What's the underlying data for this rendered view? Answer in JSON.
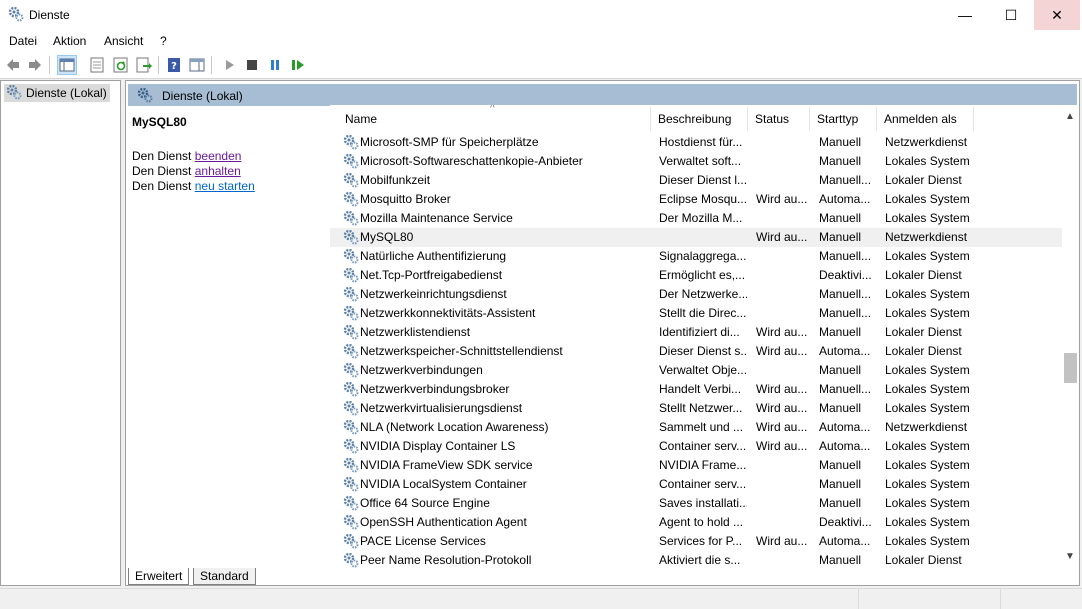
{
  "window": {
    "title": "Dienste",
    "icon": "gears-icon",
    "minimize": "—",
    "maximize": "☐",
    "close": "✕"
  },
  "menu": [
    "Datei",
    "Aktion",
    "Ansicht",
    "?"
  ],
  "tree": {
    "root": "Dienste (Lokal)"
  },
  "content": {
    "header": "Dienste (Lokal)",
    "extended": {
      "selected_service": "MySQL80",
      "line_prefix": "Den Dienst",
      "actions": [
        "beenden",
        "anhalten",
        "neu starten"
      ]
    }
  },
  "columns": [
    "Name",
    "Beschreibung",
    "Status",
    "Starttyp",
    "Anmelden als"
  ],
  "services": [
    {
      "name": "Microsoft-SMP für Speicherplätze",
      "description": "Hostdienst für...",
      "status": "",
      "startup": "Manuell",
      "logon": "Netzwerkdienst"
    },
    {
      "name": "Microsoft-Softwareschattenkopie-Anbieter",
      "description": "Verwaltet soft...",
      "status": "",
      "startup": "Manuell",
      "logon": "Lokales System"
    },
    {
      "name": "Mobilfunkzeit",
      "description": "Dieser Dienst l...",
      "status": "",
      "startup": "Manuell...",
      "logon": "Lokaler Dienst"
    },
    {
      "name": "Mosquitto Broker",
      "description": "Eclipse Mosqu...",
      "status": "Wird au...",
      "startup": "Automa...",
      "logon": "Lokales System"
    },
    {
      "name": "Mozilla Maintenance Service",
      "description": "Der Mozilla M...",
      "status": "",
      "startup": "Manuell",
      "logon": "Lokales System"
    },
    {
      "name": "MySQL80",
      "description": "",
      "status": "Wird au...",
      "startup": "Manuell",
      "logon": "Netzwerkdienst",
      "selected": true
    },
    {
      "name": "Natürliche Authentifizierung",
      "description": "Signalaggrega...",
      "status": "",
      "startup": "Manuell...",
      "logon": "Lokales System"
    },
    {
      "name": "Net.Tcp-Portfreigabedienst",
      "description": "Ermöglicht es,...",
      "status": "",
      "startup": "Deaktivi...",
      "logon": "Lokaler Dienst"
    },
    {
      "name": "Netzwerkeinrichtungsdienst",
      "description": "Der Netzwerke...",
      "status": "",
      "startup": "Manuell...",
      "logon": "Lokales System"
    },
    {
      "name": "Netzwerkkonnektivitäts-Assistent",
      "description": "Stellt die Direc...",
      "status": "",
      "startup": "Manuell...",
      "logon": "Lokales System"
    },
    {
      "name": "Netzwerklistendienst",
      "description": "Identifiziert di...",
      "status": "Wird au...",
      "startup": "Manuell",
      "logon": "Lokaler Dienst"
    },
    {
      "name": "Netzwerkspeicher-Schnittstellendienst",
      "description": "Dieser Dienst s...",
      "status": "Wird au...",
      "startup": "Automa...",
      "logon": "Lokaler Dienst"
    },
    {
      "name": "Netzwerkverbindungen",
      "description": "Verwaltet Obje...",
      "status": "",
      "startup": "Manuell",
      "logon": "Lokales System"
    },
    {
      "name": "Netzwerkverbindungsbroker",
      "description": "Handelt Verbi...",
      "status": "Wird au...",
      "startup": "Manuell...",
      "logon": "Lokales System"
    },
    {
      "name": "Netzwerkvirtualisierungsdienst",
      "description": "Stellt Netzwer...",
      "status": "Wird au...",
      "startup": "Manuell",
      "logon": "Lokales System"
    },
    {
      "name": "NLA (Network Location Awareness)",
      "description": "Sammelt und ...",
      "status": "Wird au...",
      "startup": "Automa...",
      "logon": "Netzwerkdienst"
    },
    {
      "name": "NVIDIA Display Container LS",
      "description": "Container serv...",
      "status": "Wird au...",
      "startup": "Automa...",
      "logon": "Lokales System"
    },
    {
      "name": "NVIDIA FrameView SDK service",
      "description": "NVIDIA Frame...",
      "status": "",
      "startup": "Manuell",
      "logon": "Lokales System"
    },
    {
      "name": "NVIDIA LocalSystem Container",
      "description": "Container serv...",
      "status": "",
      "startup": "Manuell",
      "logon": "Lokales System"
    },
    {
      "name": "Office 64 Source Engine",
      "description": "Saves installati...",
      "status": "",
      "startup": "Manuell",
      "logon": "Lokales System"
    },
    {
      "name": "OpenSSH Authentication Agent",
      "description": "Agent to hold ...",
      "status": "",
      "startup": "Deaktivi...",
      "logon": "Lokales System"
    },
    {
      "name": "PACE License Services",
      "description": "Services for P...",
      "status": "Wird au...",
      "startup": "Automa...",
      "logon": "Lokales System"
    },
    {
      "name": "Peer Name Resolution-Protokoll",
      "description": "Aktiviert die s...",
      "status": "",
      "startup": "Manuell",
      "logon": "Lokaler Dienst"
    }
  ],
  "tabs": [
    "Erweitert",
    "Standard"
  ],
  "active_tab": "Erweitert"
}
